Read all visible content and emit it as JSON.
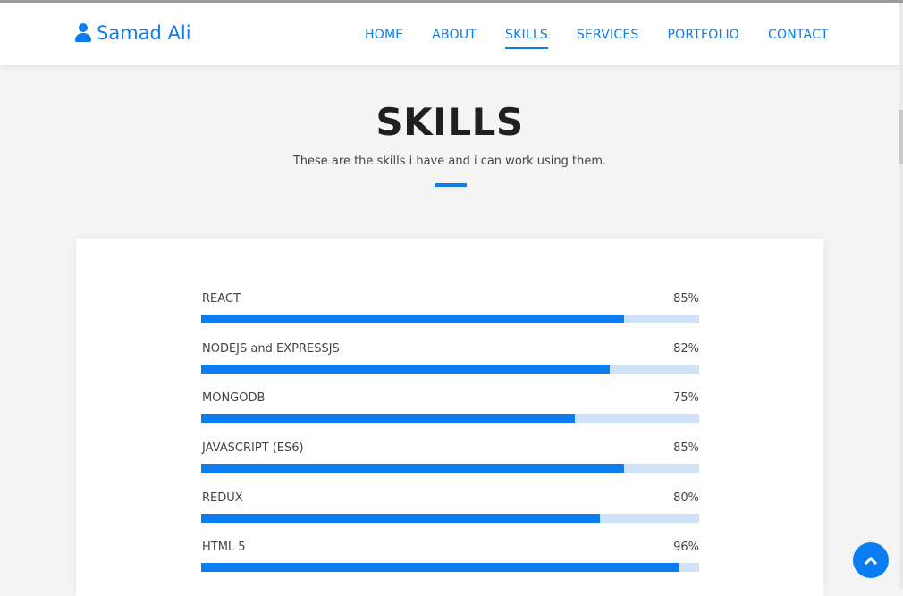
{
  "brand": {
    "name": "Samad Ali",
    "icon": "user-icon"
  },
  "nav": [
    {
      "label": "HOME"
    },
    {
      "label": "ABOUT"
    },
    {
      "label": "SKILLS",
      "active": true
    },
    {
      "label": "SERVICES"
    },
    {
      "label": "PORTFOLIO"
    },
    {
      "label": "CONTACT"
    }
  ],
  "section": {
    "title": "SKILLS",
    "subtitle": "These are the skills i have and i can work using them."
  },
  "skills": [
    {
      "name": "REACT",
      "percent_label": "85%",
      "value": 85
    },
    {
      "name": "NODEJS and EXPRESSJS",
      "percent_label": "82%",
      "value": 82
    },
    {
      "name": "MONGODB",
      "percent_label": "75%",
      "value": 75
    },
    {
      "name": "JAVASCRIPT (ES6)",
      "percent_label": "85%",
      "value": 85
    },
    {
      "name": "REDUX",
      "percent_label": "80%",
      "value": 80
    },
    {
      "name": "HTML 5",
      "percent_label": "96%",
      "value": 96
    }
  ],
  "colors": {
    "accent": "#0a7df2",
    "track": "#cfe1f7",
    "background": "#f4f4f4"
  },
  "back_to_top": {
    "icon": "chevron-up-icon"
  }
}
